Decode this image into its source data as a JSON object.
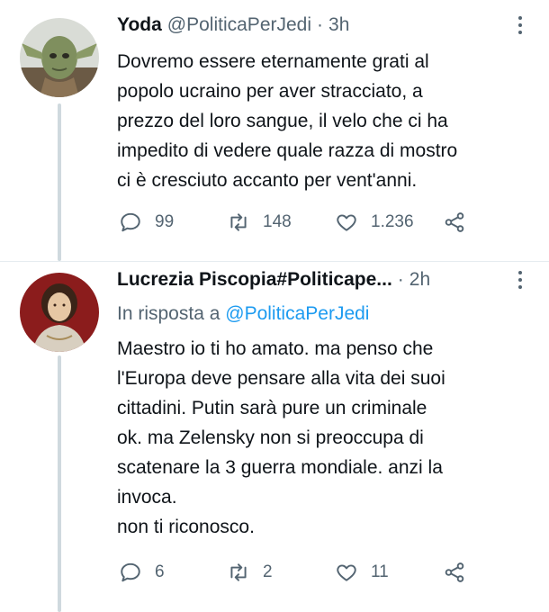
{
  "tweets": [
    {
      "author_name": "Yoda",
      "handle": "@PoliticaPerJedi",
      "separator": "·",
      "time": "3h",
      "text": "Dovremo essere eternamente grati al\npopolo ucraino per aver stracciato, a\nprezzo del loro sangue, il velo che ci ha\nimpedito di vedere quale razza di mostro\nci è cresciuto accanto per vent'anni.",
      "replies": "99",
      "retweets": "148",
      "likes": "1.236"
    },
    {
      "author_name": "Lucrezia Piscopia#Politicape...",
      "separator": "·",
      "time": "2h",
      "reply_prefix": "In risposta a",
      "reply_mention": "@PoliticaPerJedi",
      "text": "Maestro io ti ho amato. ma  penso che\nl'Europa deve pensare alla vita dei suoi\ncittadini. Putin sarà pure un criminale\nok. ma Zelensky non si preoccupa di\nscatenare la 3 guerra mondiale. anzi la\ninvoca.\nnon ti riconosco.",
      "replies": "6",
      "retweets": "2",
      "likes": "11"
    }
  ],
  "colors": {
    "text": "#0f1419",
    "secondary": "#536471",
    "link": "#1d9bf0",
    "thread_line": "#cfd9de"
  },
  "icons": [
    "reply-icon",
    "retweet-icon",
    "like-icon",
    "share-icon",
    "more-icon"
  ]
}
